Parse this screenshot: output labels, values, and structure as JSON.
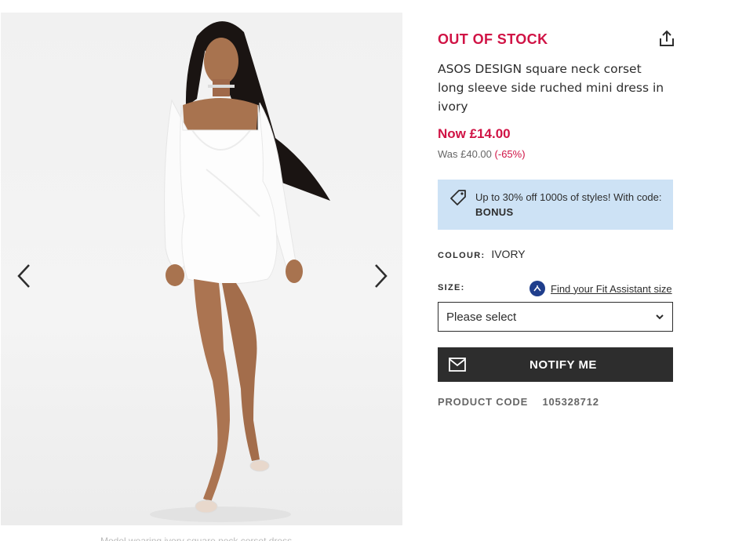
{
  "gallery": {
    "prev_icon": "chevron-left-icon",
    "next_icon": "chevron-right-icon",
    "caption": "Model wearing ivory square neck corset dress"
  },
  "product": {
    "stock_status": "OUT OF STOCK",
    "share_icon": "share-icon",
    "title": "ASOS DESIGN square neck corset long sleeve side ruched mini dress in ivory",
    "price_now": "Now £14.00",
    "price_was": "Was £40.00",
    "discount": "(-65%)"
  },
  "promo": {
    "icon": "price-tag-icon",
    "text": "Up to 30% off 1000s of styles! With code:",
    "code": "BONUS",
    "background": "#cde2f5"
  },
  "colour": {
    "label": "COLOUR:",
    "value": "IVORY"
  },
  "size": {
    "label": "SIZE:",
    "fit_assistant_link": "Find your Fit Assistant size",
    "select_value": "Please select",
    "select_icon": "chevron-down-icon"
  },
  "notify": {
    "label": "NOTIFY ME",
    "icon": "mail-icon"
  },
  "product_code": {
    "label": "PRODUCT CODE",
    "value": "105328712"
  },
  "colors": {
    "accent": "#d01345",
    "dark": "#2d2d2d",
    "muted": "#666666"
  }
}
